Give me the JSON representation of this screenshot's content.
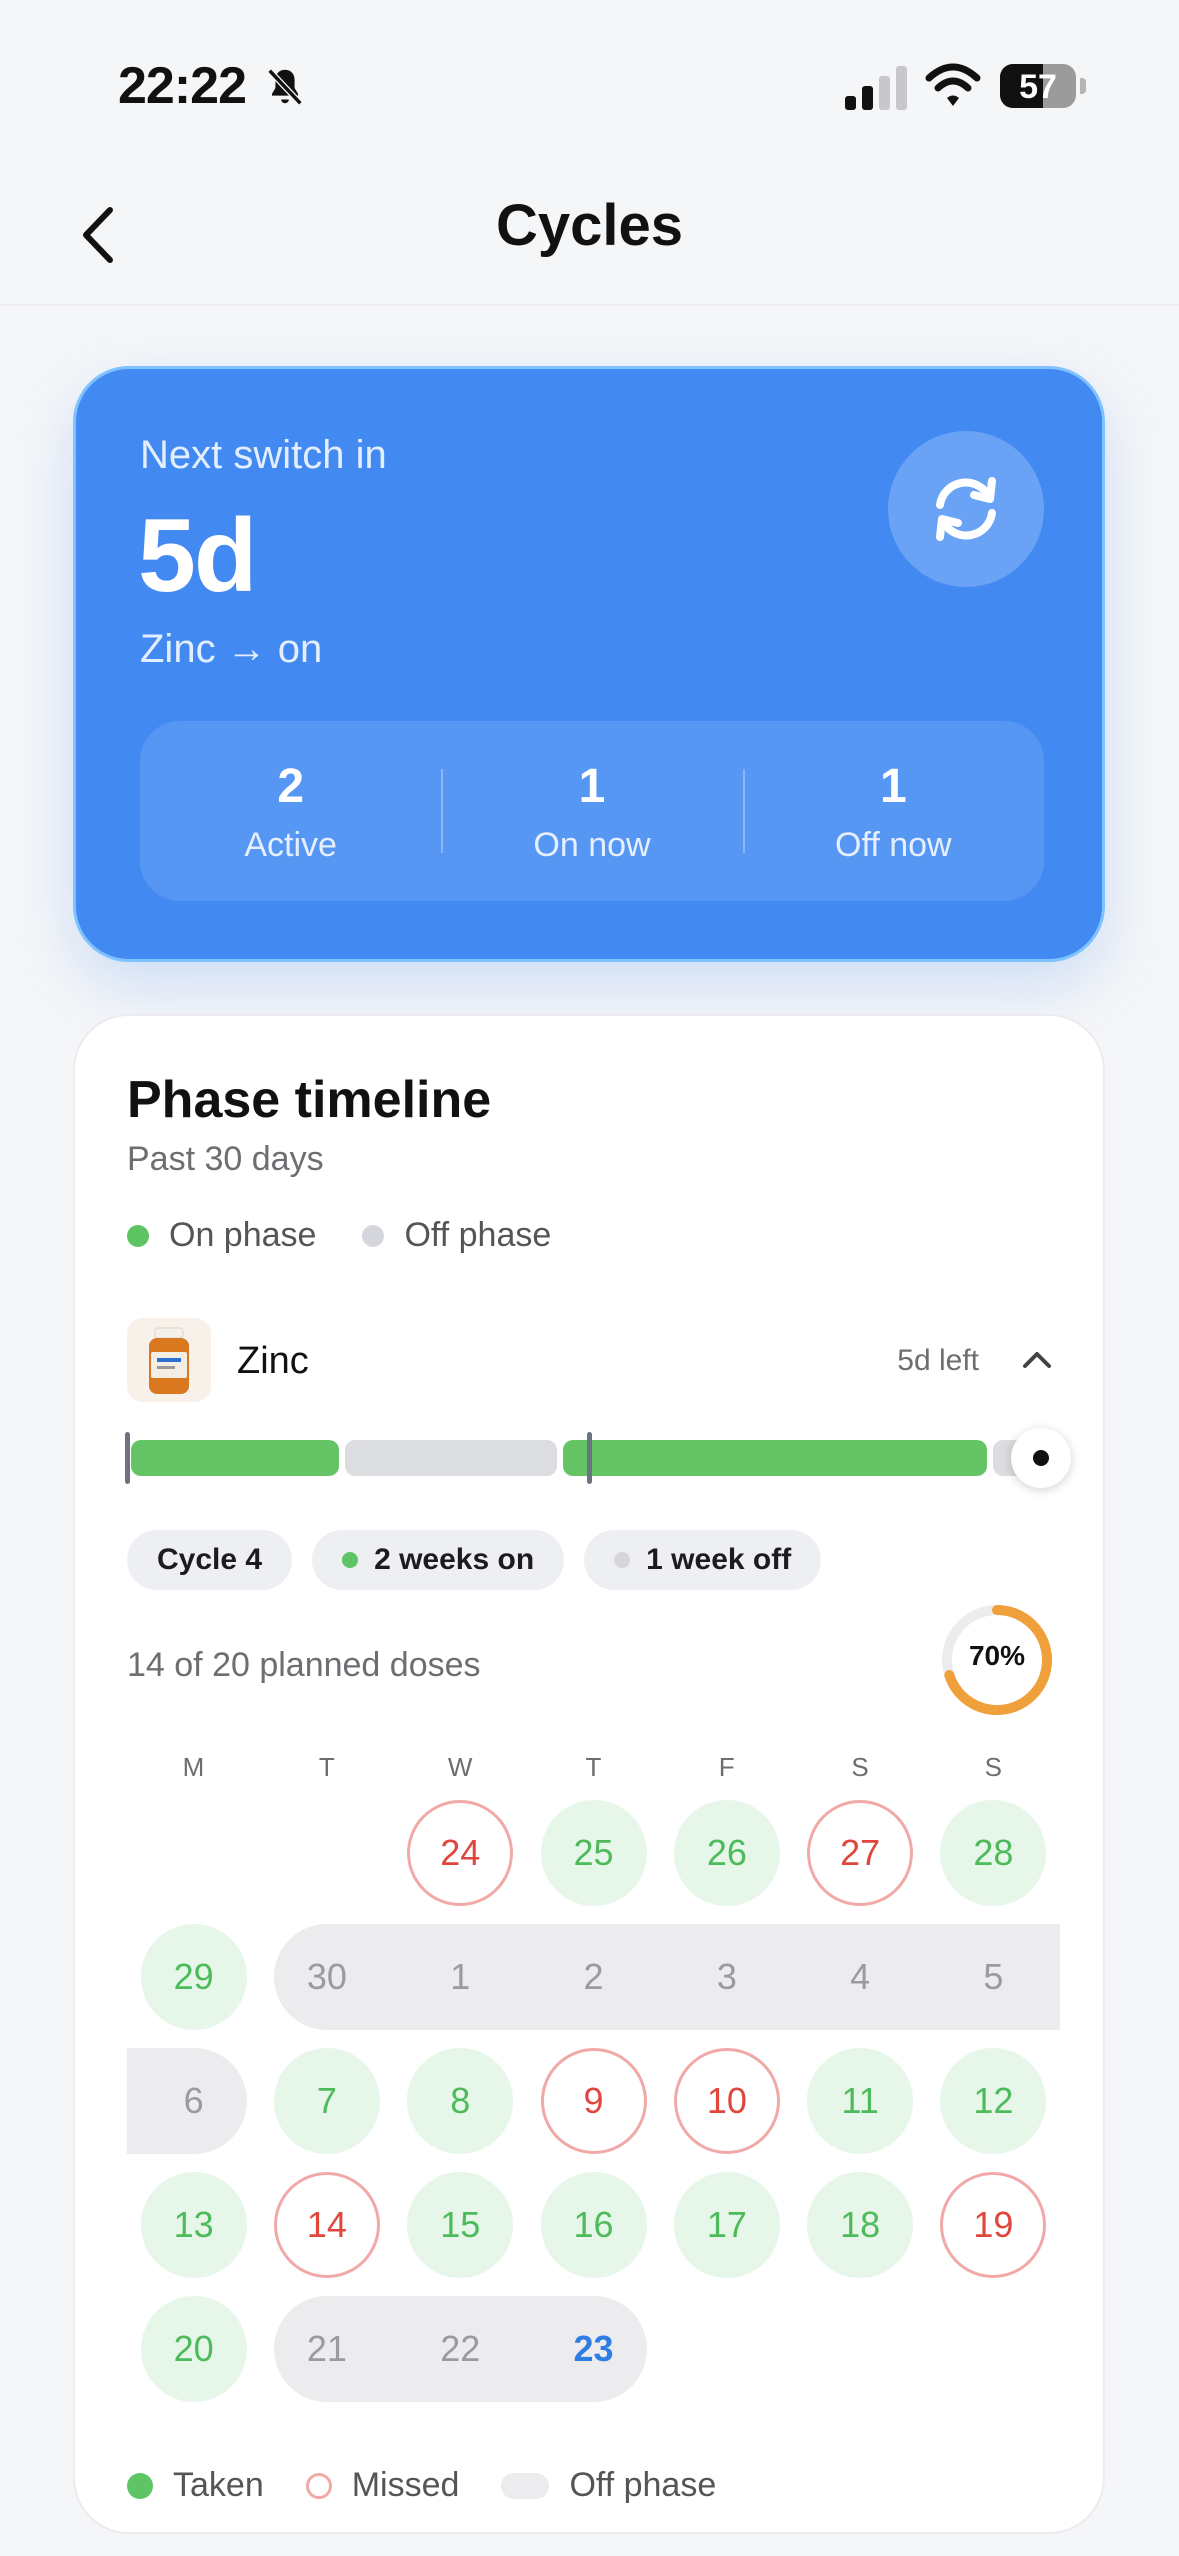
{
  "status_bar": {
    "time": "22:22",
    "battery": "57",
    "battery_level": 0.57
  },
  "header": {
    "title": "Cycles"
  },
  "hero": {
    "label": "Next switch in",
    "value": "5d",
    "subtitle": "Zinc → on",
    "stats": [
      {
        "value": "2",
        "label": "Active"
      },
      {
        "value": "1",
        "label": "On now"
      },
      {
        "value": "1",
        "label": "Off now"
      }
    ]
  },
  "timeline": {
    "title": "Phase timeline",
    "subtitle": "Past 30 days",
    "legend": {
      "on": "On phase",
      "off": "Off phase"
    },
    "supplement": {
      "name": "Zinc",
      "remaining": "5d left"
    },
    "chips": {
      "cycle": "Cycle 4",
      "on": "2 weeks on",
      "off": "1 week off"
    },
    "doses": "14 of 20 planned doses",
    "percent_label": "70%",
    "percent": 0.7,
    "weekdays": [
      "M",
      "T",
      "W",
      "T",
      "F",
      "S",
      "S"
    ],
    "days": [
      {
        "n": "24",
        "s": "missed"
      },
      {
        "n": "25",
        "s": "taken"
      },
      {
        "n": "26",
        "s": "taken"
      },
      {
        "n": "27",
        "s": "missed"
      },
      {
        "n": "28",
        "s": "taken"
      },
      {
        "n": "29",
        "s": "taken"
      },
      {
        "n": "30",
        "s": "off"
      },
      {
        "n": "1",
        "s": "off"
      },
      {
        "n": "2",
        "s": "off"
      },
      {
        "n": "3",
        "s": "off"
      },
      {
        "n": "4",
        "s": "off"
      },
      {
        "n": "5",
        "s": "off"
      },
      {
        "n": "6",
        "s": "off"
      },
      {
        "n": "7",
        "s": "taken"
      },
      {
        "n": "8",
        "s": "taken"
      },
      {
        "n": "9",
        "s": "missed"
      },
      {
        "n": "10",
        "s": "missed"
      },
      {
        "n": "11",
        "s": "taken"
      },
      {
        "n": "12",
        "s": "taken"
      },
      {
        "n": "13",
        "s": "taken"
      },
      {
        "n": "14",
        "s": "missed"
      },
      {
        "n": "15",
        "s": "taken"
      },
      {
        "n": "16",
        "s": "taken"
      },
      {
        "n": "17",
        "s": "taken"
      },
      {
        "n": "18",
        "s": "taken"
      },
      {
        "n": "19",
        "s": "missed"
      },
      {
        "n": "20",
        "s": "taken"
      },
      {
        "n": "21",
        "s": "off"
      },
      {
        "n": "22",
        "s": "off"
      },
      {
        "n": "23",
        "s": "today"
      }
    ],
    "bottom_legend": {
      "taken": "Taken",
      "missed": "Missed",
      "off": "Off phase"
    }
  },
  "colors": {
    "accent": "#4289f2",
    "on": "#5ec464",
    "missed": "#e0463d",
    "ring": "#f0a03a"
  }
}
